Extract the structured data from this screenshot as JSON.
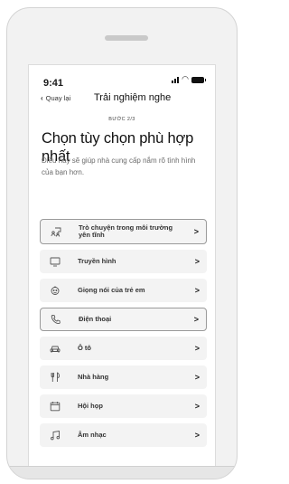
{
  "status_bar": {
    "time": "9:41"
  },
  "nav": {
    "back_label": "Quay lại",
    "title": "Trải nghiệm nghe"
  },
  "step_indicator": "BƯỚC 2/3",
  "heading": "Chọn tùy chọn phù hợp nhất",
  "description": "Điều này sẽ giúp nhà cung cấp nắm rõ tình hình của bạn hơn.",
  "options": [
    {
      "label": "Trò chuyện trong môi trường yên tĩnh",
      "icon": "quiet-conversation-icon",
      "selected": true
    },
    {
      "label": "Truyền hình",
      "icon": "tv-icon",
      "selected": false
    },
    {
      "label": "Giọng nói của trẻ em",
      "icon": "child-face-icon",
      "selected": false
    },
    {
      "label": "Điện thoại",
      "icon": "phone-icon",
      "selected": true
    },
    {
      "label": "Ô tô",
      "icon": "car-icon",
      "selected": false
    },
    {
      "label": "Nhà hàng",
      "icon": "restaurant-icon",
      "selected": false
    },
    {
      "label": "Hội họp",
      "icon": "calendar-icon",
      "selected": false
    },
    {
      "label": "Âm nhạc",
      "icon": "music-icon",
      "selected": false
    }
  ],
  "chevron": ">"
}
